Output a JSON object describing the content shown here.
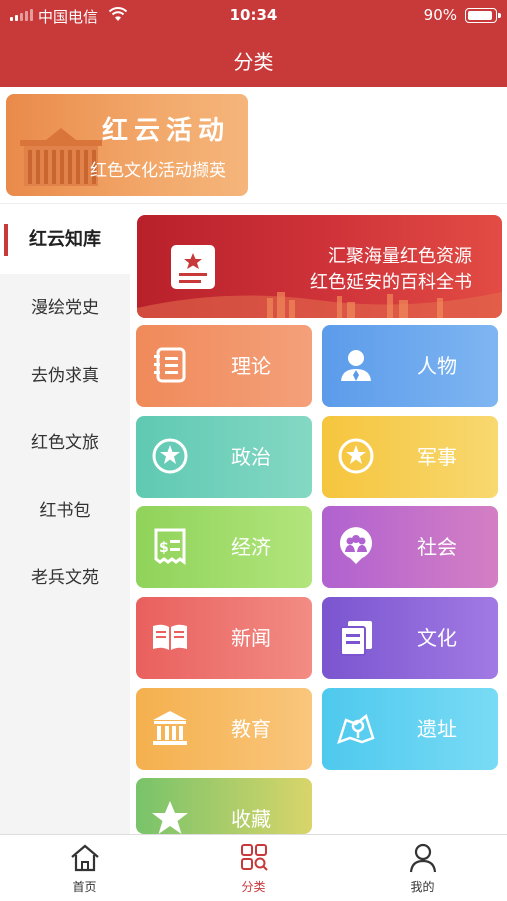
{
  "status_bar": {
    "carrier": "中国电信",
    "time": "10:34",
    "battery": "90%"
  },
  "nav": {
    "title": "分类"
  },
  "banner_top": {
    "title": "红云活动",
    "subtitle": "红色文化活动撷英"
  },
  "sidebar": {
    "items": [
      {
        "label": "红云知库",
        "active": true
      },
      {
        "label": "漫绘党史"
      },
      {
        "label": "去伪求真"
      },
      {
        "label": "红色文旅"
      },
      {
        "label": "红书包"
      },
      {
        "label": "老兵文苑"
      }
    ]
  },
  "main_banner": {
    "line1": "汇聚海量红色资源",
    "line2": "红色延安的百科全书"
  },
  "categories": [
    {
      "label": "理论",
      "icon": "notebook-icon"
    },
    {
      "label": "人物",
      "icon": "person-icon"
    },
    {
      "label": "政治",
      "icon": "emblem-icon"
    },
    {
      "label": "军事",
      "icon": "star-badge-icon"
    },
    {
      "label": "经济",
      "icon": "receipt-icon"
    },
    {
      "label": "社会",
      "icon": "people-group-icon"
    },
    {
      "label": "新闻",
      "icon": "open-book-icon"
    },
    {
      "label": "文化",
      "icon": "documents-icon"
    },
    {
      "label": "教育",
      "icon": "institution-icon"
    },
    {
      "label": "遗址",
      "icon": "map-icon"
    },
    {
      "label": "收藏",
      "icon": "star-icon"
    }
  ],
  "tabbar": {
    "items": [
      {
        "label": "首页",
        "icon": "home-icon"
      },
      {
        "label": "分类",
        "icon": "category-grid-icon",
        "active": true
      },
      {
        "label": "我的",
        "icon": "user-icon"
      }
    ]
  },
  "colors": {
    "brand_red": "#c8393a"
  }
}
